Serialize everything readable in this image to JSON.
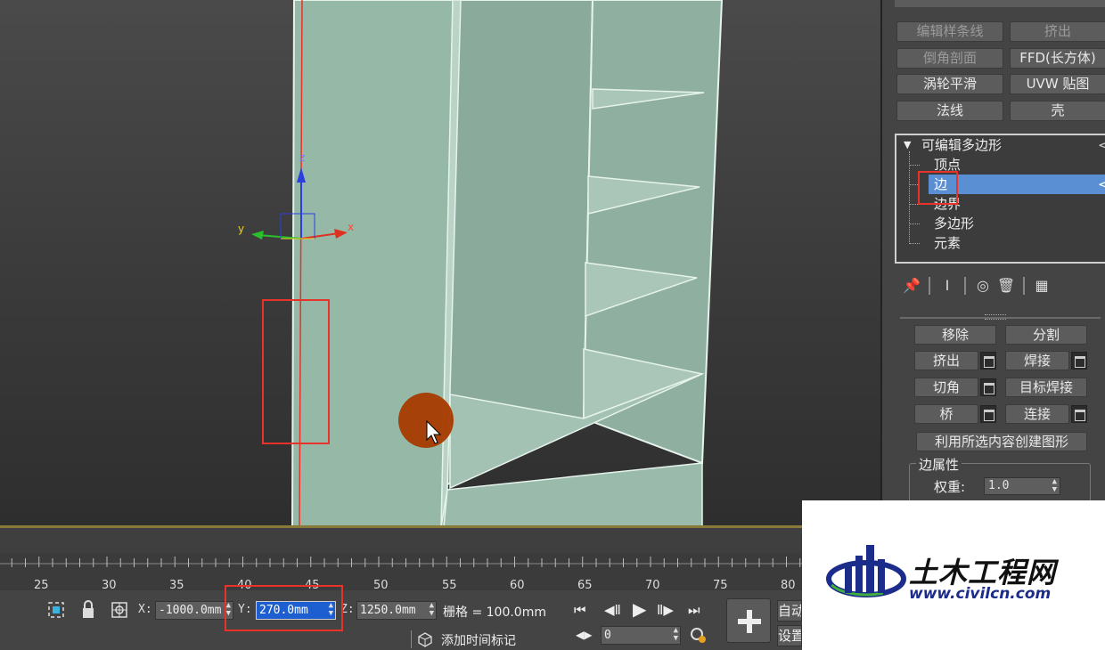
{
  "modifier_list": {
    "buttons": [
      {
        "label": "编辑样条线",
        "dim": true
      },
      {
        "label": "挤出",
        "dim": true
      },
      {
        "label": "倒角剖面",
        "dim": true
      },
      {
        "label": "FFD(长方体)",
        "dim": false
      },
      {
        "label": "涡轮平滑",
        "dim": false
      },
      {
        "label": "UVW 贴图",
        "dim": false
      },
      {
        "label": "法线",
        "dim": false
      },
      {
        "label": "壳",
        "dim": false
      }
    ]
  },
  "modifier_stack": {
    "root": "可编辑多边形",
    "collapse_glyph": "▼",
    "items": [
      "顶点",
      "边",
      "边界",
      "多边形",
      "元素"
    ],
    "selected": "边",
    "eye_glyph": "<"
  },
  "stack_tools": {
    "pin": "📌",
    "show_end": "Ⅰ",
    "unique": "◎",
    "remove": "🗑",
    "configure": "▦"
  },
  "edit_edges": {
    "remove": "移除",
    "split": "分割",
    "extrude": "挤出",
    "weld": "焊接",
    "chamfer": "切角",
    "target_weld": "目标焊接",
    "bridge": "桥",
    "connect": "连接",
    "create_shape": "利用所选内容创建图形",
    "edge_props_title": "边属性",
    "weight_label": "权重:",
    "weight_value": "1.0"
  },
  "timeline": {
    "ticks": [
      "25",
      "30",
      "35",
      "40",
      "45",
      "50",
      "55",
      "60",
      "65",
      "70",
      "75",
      "80"
    ]
  },
  "status_bar": {
    "x_label": "X:",
    "x_value": "-1000.0mm",
    "y_label": "Y:",
    "y_value": "270.0mm",
    "z_label": "Z:",
    "z_value": "1250.0mm",
    "grid_text": "栅格 = 100.0mm",
    "add_time_tag": "添加时间标记",
    "frame_value": "0",
    "auto_key": "自动",
    "set_key": "设置"
  },
  "gizmo": {
    "x": "x",
    "y": "y",
    "z": "z"
  },
  "logo": {
    "name": "土木工程网",
    "url": "www.civilcn.com"
  },
  "colors": {
    "selection": "#5b8fd4",
    "highlight_box": "#e8332b",
    "mesh_fill": "#93b5a4",
    "active_field": "#1d5fd1"
  }
}
